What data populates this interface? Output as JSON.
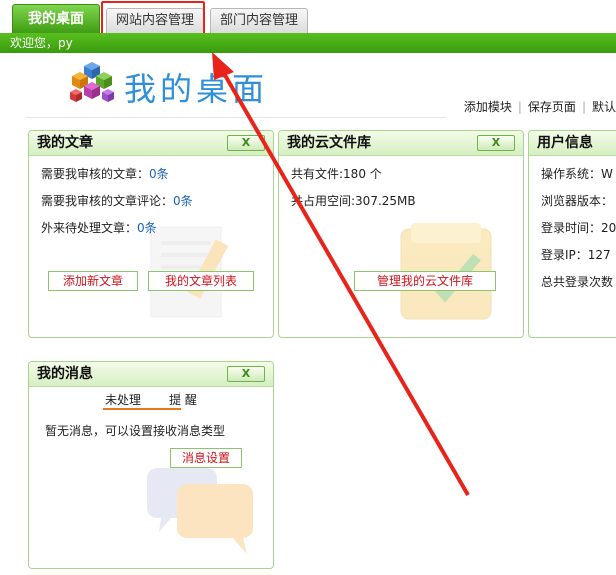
{
  "tabs": [
    {
      "label": "我的桌面"
    },
    {
      "label": "网站内容管理"
    },
    {
      "label": "部门内容管理"
    }
  ],
  "welcome_text": "欢迎您，py",
  "page_title": "我的桌面",
  "header_links": [
    "添加模块",
    "保存页面",
    "默认"
  ],
  "panels": {
    "articles": {
      "title": "我的文章",
      "close_label": "X",
      "rows": [
        {
          "label": "需要我审核的文章：",
          "value": "0条"
        },
        {
          "label": "需要我审核的文章评论：",
          "value": "0条"
        },
        {
          "label": "外来待处理文章：",
          "value": "0条"
        }
      ],
      "buttons": [
        "添加新文章",
        "我的文章列表"
      ]
    },
    "cloud": {
      "title": "我的云文件库",
      "close_label": "X",
      "rows": [
        "共有文件:180 个",
        "共占用空间:307.25MB"
      ],
      "button": "管理我的云文件库"
    },
    "user": {
      "title": "用户信息",
      "rows": [
        "操作系统：W",
        "浏览器版本：",
        "登录时间：20",
        "登录IP：127",
        "总共登录次数"
      ]
    },
    "messages": {
      "title": "我的消息",
      "close_label": "X",
      "tabs": [
        "未处理",
        "提 醒"
      ],
      "empty_text": "暂无消息，可以设置接收消息类型",
      "button": "消息设置"
    }
  },
  "colors": {
    "brand_green": "#3d9a12",
    "link_blue": "#1a64b5",
    "heading_blue": "#2f8fd8",
    "annotation_red": "#e8231a"
  }
}
